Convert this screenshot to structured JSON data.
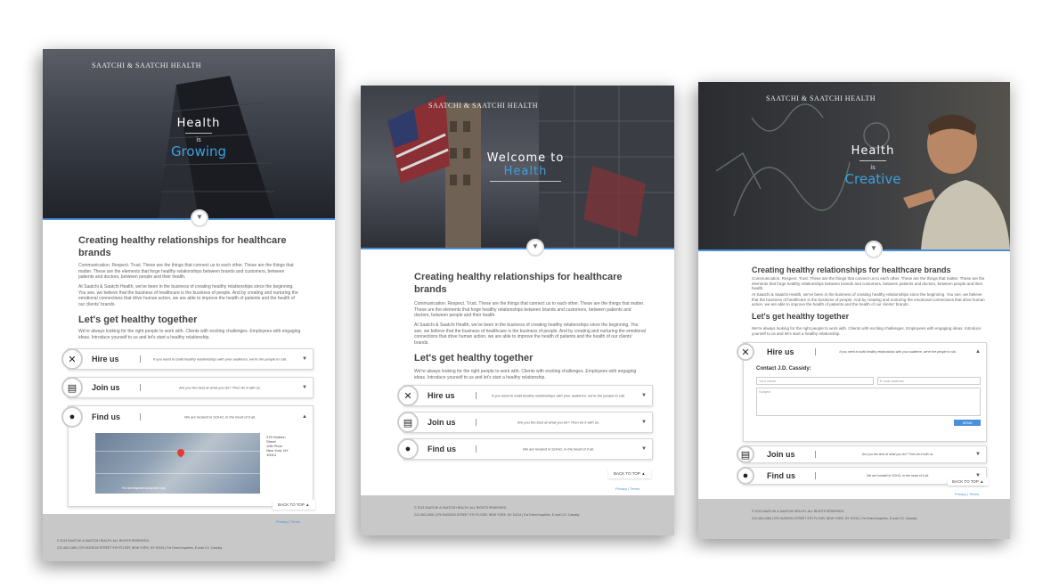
{
  "brand": "SAATCHI & SAATCHI HEALTH",
  "heroes": [
    {
      "line1": "Health",
      "line2": "is",
      "line3": "Growing"
    },
    {
      "line1": "Welcome to",
      "line3": "Health"
    },
    {
      "line1": "Health",
      "line2": "is",
      "line3": "Creative"
    }
  ],
  "intro": {
    "heading": "Creating healthy relationships for healthcare brands",
    "para1": "Communication. Respect. Trust. These are the things that connect us to each other. These are the things that matter. These are the elements that forge healthy relationships between brands and customers, between patients and doctors, between people and their health.",
    "para2": "At Saatchi & Saatchi Health, we've been in the business of creating healthy relationships since the beginning. You see, we believe that the business of healthcare is the business of people. And by creating and nurturing the emotional connections that drive human action, we are able to improve the health of patients and the health of our clients' brands."
  },
  "together": {
    "heading": "Let's get healthy together",
    "para": "We're always looking for the right people to work with. Clients with exciting challenges. Employees with engaging ideas. Introduce yourself to us and let's start a healthy relationship."
  },
  "accordion": [
    {
      "label": "Hire us",
      "icon": "close-icon",
      "desc": "If you need to build healthy relationships with your audience, we're the people to call."
    },
    {
      "label": "Join us",
      "icon": "newspaper-icon",
      "desc": "Are you the best at what you do? Then do it with us."
    },
    {
      "label": "Find us",
      "icon": "map-pin-icon",
      "desc": "We are located in SOHO, in the heart of it all."
    }
  ],
  "address": {
    "line1": "375 Hudson",
    "line2": "Street",
    "line3": "10th Floor",
    "line4": "New York, NY",
    "line5": "10014"
  },
  "map_caption": "For development purposes only",
  "contact": {
    "heading": "Contact J.D. Cassidy:",
    "name_placeholder": "Your name",
    "email_placeholder": "E-mail address",
    "subject_placeholder": "Subject",
    "send_label": "SEND"
  },
  "back_to_top": "BACK TO TOP",
  "footer_links": {
    "privacy": "Privacy",
    "terms": "Terms"
  },
  "footer": {
    "copyright": "© 2013 SAATCHI & SAATCHI HEALTH. ALL RIGHTS RESERVED.",
    "contact": "212-463-2466  |  375 HUDSON STREET 9TH FLOOR, NEW YORK, NY 10014  |  For Direct Inquiries, E-mail J.D. Cassidy"
  },
  "colors": {
    "accent": "#4a90d9",
    "hero_highlight": "#3ea0e0",
    "footer_bg": "#c8c8c8"
  }
}
